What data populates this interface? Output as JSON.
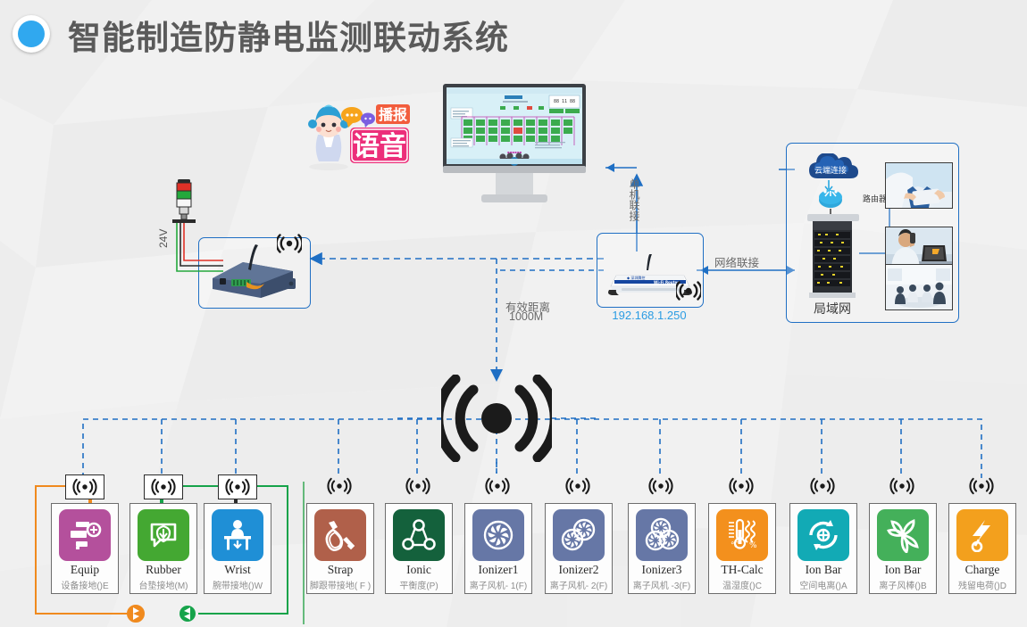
{
  "header": {
    "title": "智能制造防静电监测联动系统",
    "logo_icon": "blue-circle-icon"
  },
  "colors": {
    "accent_blue": "#1f6fc4",
    "link_blue": "#2b9ce3",
    "page_bg": "#f0f0f0",
    "wire_orange": "#f08a1e",
    "wire_green": "#16a34a",
    "wire_black": "#2b2b2b"
  },
  "diagram": {
    "mascot": {
      "name": "voice-broadcast-mascot",
      "text_main": "语音",
      "text_sub": "播报"
    },
    "monitor": {
      "name": "desktop-monitor",
      "screen_caption": "monitoring-dashboard"
    },
    "tower_light": {
      "name": "alarm-tower-light",
      "voltage_label": "24V",
      "segments": [
        "red",
        "green",
        "white"
      ]
    },
    "gateway": {
      "name": "wireless-gateway-box",
      "wifi_icon": "wifi-signal-icon"
    },
    "router": {
      "name": "wireless-router",
      "ip_label": "192.168.1.250",
      "wifi_icon": "wifi-signal-icon"
    },
    "links": {
      "serial_label": "单机联接",
      "network_label": "网络联接",
      "range_label_line1": "有效距离",
      "range_label_line2": "1000M"
    },
    "lan": {
      "cloud_label": "云端连接",
      "router_label": "路由器",
      "lan_label": "局域网",
      "photos": [
        "tablet-user-photo",
        "phone-laptop-photo",
        "meeting-room-photo"
      ]
    },
    "central_hub": {
      "name": "central-wireless-hub",
      "icon": "wifi-broadcast-icon"
    }
  },
  "devices": [
    {
      "name": "Equip",
      "sub": "设备接地()E",
      "color": "#b4509c",
      "icon": "equipment-ground-icon",
      "badge": "boxed",
      "wire": "#f08a1e"
    },
    {
      "name": "Rubber",
      "sub": "台垫接地(M)",
      "color": "#44a832",
      "icon": "mat-ground-icon",
      "badge": "boxed",
      "wire": "#16a34a"
    },
    {
      "name": "Wrist",
      "sub": "腕带接地()W",
      "color": "#1f8fd6",
      "icon": "wrist-strap-icon",
      "badge": "boxed",
      "wire": "#2b2b2b"
    },
    {
      "name": "Strap",
      "sub": "脚跟带接地( F )",
      "color": "#b0604a",
      "icon": "heel-strap-icon",
      "badge": "plain",
      "wire": ""
    },
    {
      "name": "Ionic",
      "sub": "平衡度(P)",
      "color": "#14613c",
      "icon": "ion-balance-icon",
      "badge": "plain",
      "wire": ""
    },
    {
      "name": "Ionizer1",
      "sub": "离子风机- 1(F)",
      "color": "#6677a6",
      "icon": "ionizer-fan1-icon",
      "badge": "plain",
      "wire": ""
    },
    {
      "name": "Ionizer2",
      "sub": "离子风机- 2(F)",
      "color": "#6677a6",
      "icon": "ionizer-fan2-icon",
      "badge": "plain",
      "wire": ""
    },
    {
      "name": "Ionizer3",
      "sub": "离子风机 -3(F)",
      "color": "#6677a6",
      "icon": "ionizer-fan3-icon",
      "badge": "plain",
      "wire": ""
    },
    {
      "name": "TH-Calc",
      "sub": "温湿度()C",
      "color": "#f3901d",
      "icon": "temp-humidity-icon",
      "badge": "plain",
      "wire": ""
    },
    {
      "name": "Ion Bar",
      "sub": "空间电离()A",
      "color": "#12aab5",
      "icon": "space-ionization-icon",
      "badge": "plain",
      "wire": ""
    },
    {
      "name": "Ion Bar",
      "sub": "离子风棒()B",
      "color": "#44b05a",
      "icon": "ion-bar-icon",
      "badge": "plain",
      "wire": ""
    },
    {
      "name": "Charge",
      "sub": "残留电荷()D",
      "color": "#f3a01d",
      "icon": "residual-charge-icon",
      "badge": "plain",
      "wire": ""
    }
  ]
}
